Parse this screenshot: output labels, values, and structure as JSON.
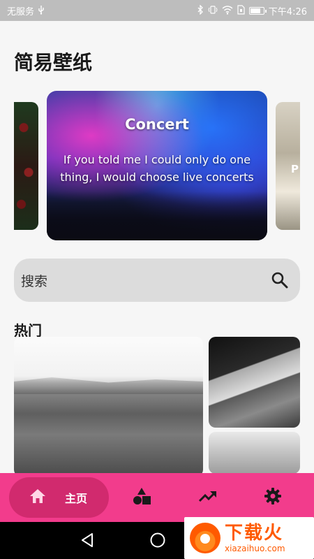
{
  "status_bar": {
    "carrier": "无服务",
    "time": "下午4:26",
    "battery_level": 0.85,
    "icons": [
      "usb-icon",
      "bluetooth-icon",
      "vibrate-icon",
      "wifi-icon",
      "sim-icon",
      "battery-icon"
    ]
  },
  "app": {
    "title": "简易壁纸"
  },
  "carousel": {
    "featured": {
      "title": "Concert",
      "description": "If you told me I could only do one thing, I would choose live concerts"
    },
    "right_peek_text": "P"
  },
  "search": {
    "placeholder": "搜索",
    "icon": "search-icon"
  },
  "section": {
    "title": "热门"
  },
  "bottom_nav": {
    "items": [
      {
        "label": "主页",
        "icon": "home-icon",
        "active": true
      },
      {
        "label": "",
        "icon": "categories-icon",
        "active": false
      },
      {
        "label": "",
        "icon": "trending-icon",
        "active": false
      },
      {
        "label": "",
        "icon": "settings-icon",
        "active": false
      }
    ]
  },
  "system_nav": {
    "icons": [
      "back-icon",
      "home-circle-icon"
    ]
  },
  "watermark": {
    "cn": "下载火",
    "en": "xiazaihuo.com"
  },
  "colors": {
    "nav_bar": "#f23c8c",
    "nav_active_pill": "#d12a6e",
    "search_bg": "#dcdcdc",
    "status_bar": "#bdbdbd",
    "watermark": "#ff5a00"
  }
}
